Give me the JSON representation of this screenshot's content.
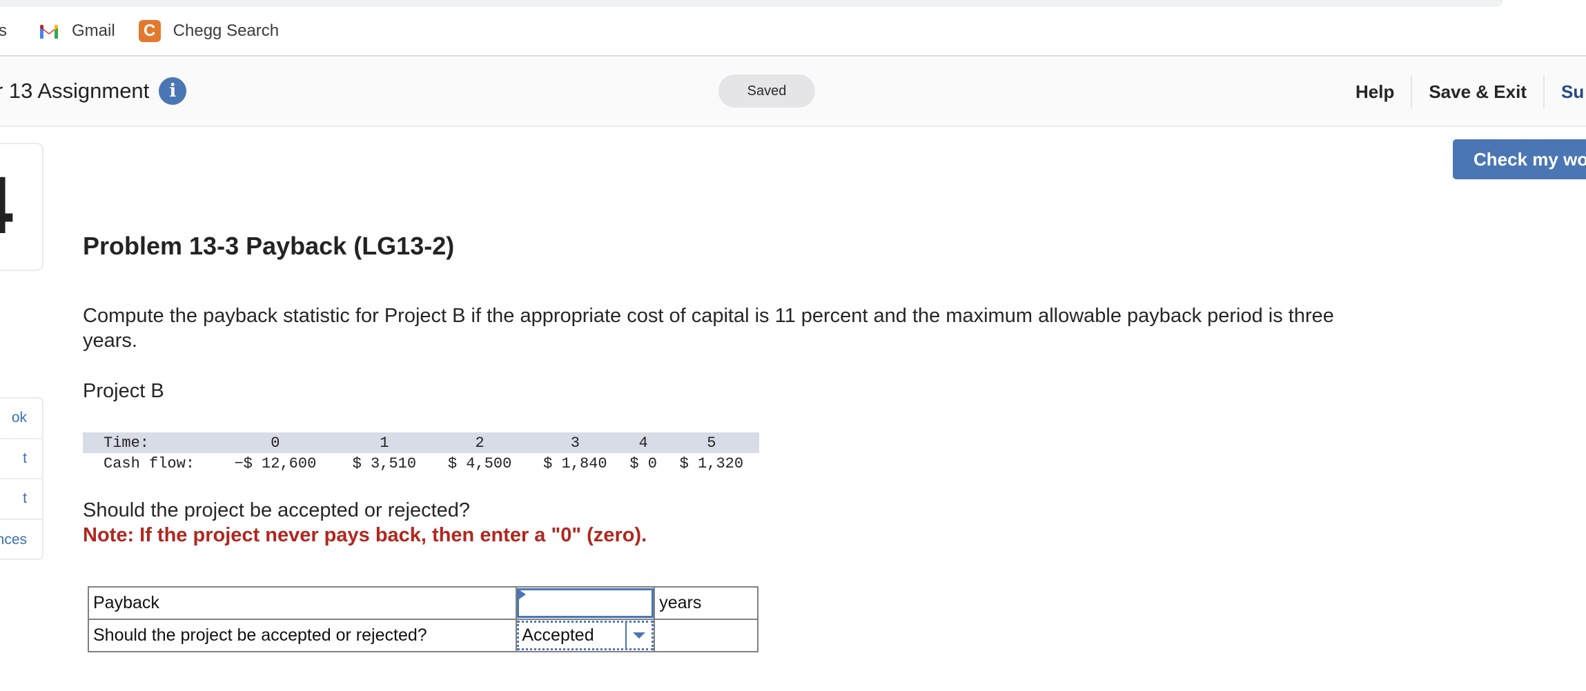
{
  "browser": {
    "bookmarks": [
      {
        "label": "s",
        "icon": "folder-icon"
      },
      {
        "label": "Gmail",
        "icon": "gmail-icon"
      },
      {
        "label": "Chegg Search",
        "icon": "chegg-icon"
      }
    ],
    "chegg_icon_letter": "C"
  },
  "header": {
    "assignment_title": "r 13 Assignment",
    "info_icon_glyph": "i",
    "status": "Saved",
    "links": {
      "help": "Help",
      "save_exit": "Save & Exit",
      "submit": "Su"
    }
  },
  "check_button": "Check my wo",
  "question_number": "4",
  "sidebar_tools": [
    "ok",
    "t",
    "t",
    "nces"
  ],
  "problem": {
    "title": "Problem 13-3 Payback (LG13-2)",
    "prompt": "Compute the payback statistic for Project B if the appropriate cost of capital is 11 percent and the maximum allowable payback period is three years.",
    "project_label": "Project B",
    "cash_flow_table": {
      "time_label": "Time:",
      "cash_flow_label": "Cash flow:",
      "periods": [
        "0",
        "1",
        "2",
        "3",
        "4",
        "5"
      ],
      "cash_flows": [
        "−$ 12,600",
        "$ 3,510",
        "$ 4,500",
        "$ 1,840",
        "$ 0",
        "$ 1,320"
      ]
    },
    "question": "Should the project be accepted or rejected?",
    "note": "Note: If the project never pays back, then enter a \"0\" (zero)."
  },
  "answers": {
    "payback": {
      "label": "Payback",
      "value": "",
      "units": "years"
    },
    "decision": {
      "label": "Should the project be accepted or rejected?",
      "selected": "Accepted",
      "units": ""
    }
  },
  "colors": {
    "accent": "#4a76b4",
    "note_red": "#b3261e",
    "submit_blue": "#234a86",
    "chegg_orange": "#e27a2e"
  }
}
